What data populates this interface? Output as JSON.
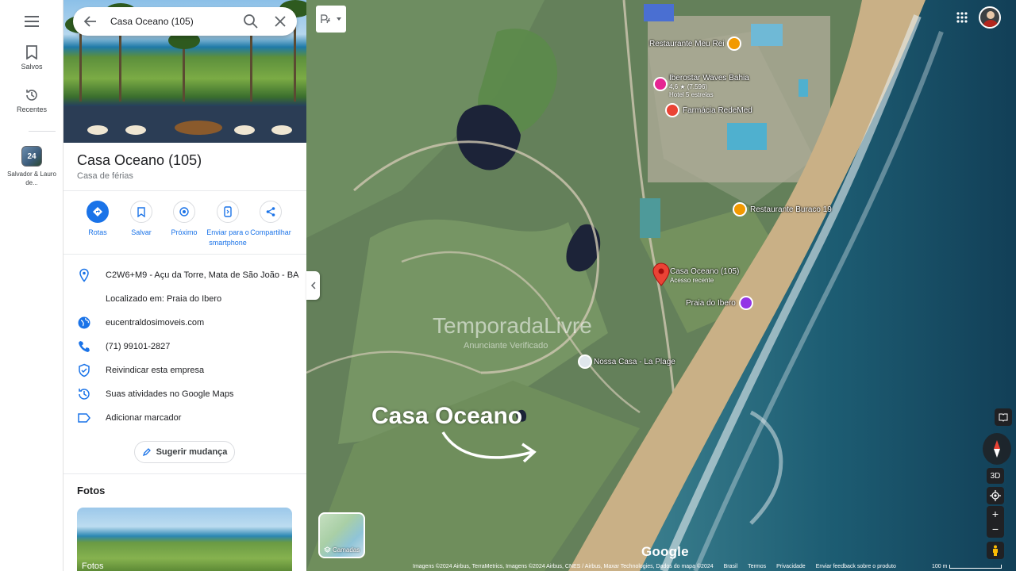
{
  "rail": {
    "saved_label": "Salvos",
    "recent_label": "Recentes",
    "recent_item_badge": "24",
    "recent_item_label": "Salvador & Lauro de..."
  },
  "search": {
    "value": "Casa Oceano (105)"
  },
  "place": {
    "title": "Casa Oceano (105)",
    "category": "Casa de férias"
  },
  "actions": [
    {
      "label": "Rotas"
    },
    {
      "label": "Salvar"
    },
    {
      "label": "Próximo"
    },
    {
      "label": "Enviar para o smartphone"
    },
    {
      "label": "Compartilhar"
    }
  ],
  "info": {
    "address": "C2W6+M9 - Açu da Torre, Mata de São João - BA",
    "located_in": "Localizado em: Praia do Ibero",
    "website": "eucentraldosimoveis.com",
    "phone": "(71) 99101-2827",
    "claim": "Reivindicar esta empresa",
    "activity": "Suas atividades no Google Maps",
    "add_label": "Adicionar marcador"
  },
  "suggest_label": "Sugerir mudança",
  "photos": {
    "heading": "Fotos",
    "card_label": "Fotos"
  },
  "map": {
    "pois": [
      {
        "name": "Restaurante Meu Rei"
      },
      {
        "name": "Iberostar Waves Bahia",
        "rating": "4,6 ★ (7.596)",
        "sub": "Hotel 5 estrelas"
      },
      {
        "name": "Farmácia RedeMed"
      },
      {
        "name": "Restaurante Buraco 19"
      },
      {
        "name": "Casa Oceano (105)",
        "sub": "Acesso recente"
      },
      {
        "name": "Praia do Ibero"
      },
      {
        "name": "Nossa Casa - La Plage"
      }
    ],
    "watermark": "TemporadaLivre",
    "watermark_sub": "Anunciante Verificado",
    "overlay_text": "Casa Oceano",
    "layers_label": "Camadas",
    "label_3d": "3D",
    "google": "Google",
    "footer": [
      "Imagens ©2024 Airbus, TerraMetrics, Imagens ©2024 Airbus, CNES / Airbus, Maxar Technologies, Dados do mapa ©2024",
      "Brasil",
      "Termos",
      "Privacidade",
      "Enviar feedback sobre o produto"
    ],
    "scale": "100 m"
  },
  "colors": {
    "accent": "#1a73e8",
    "pin_red": "#ea4335",
    "poi_orange": "#f29900",
    "poi_pink": "#e52592",
    "poi_purple": "#9334e6"
  }
}
